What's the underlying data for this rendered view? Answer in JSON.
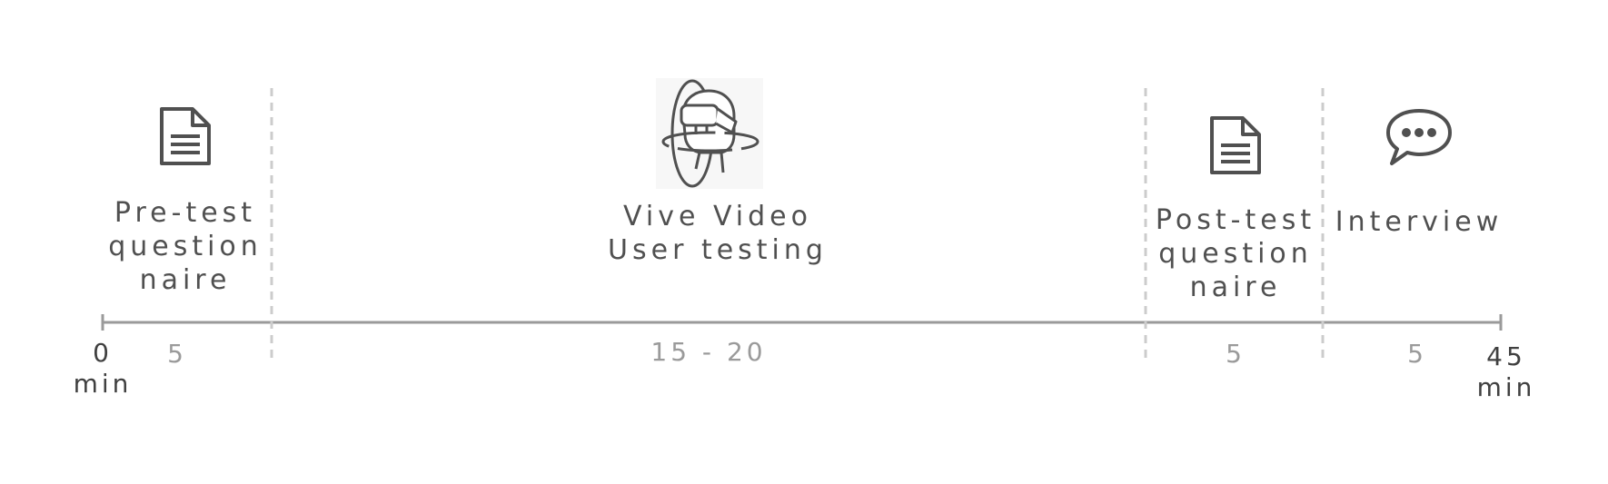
{
  "phases": [
    {
      "label": "Pre-test\nquestion\nnaire",
      "icon": "document-icon",
      "duration": "5"
    },
    {
      "label": "Vive Video\nUser testing",
      "icon": "vr-headset-user-icon",
      "duration": "15 - 20"
    },
    {
      "label": "Post-test\nquestion\nnaire",
      "icon": "document-icon",
      "duration": "5"
    },
    {
      "label": "Interview",
      "icon": "speech-bubble-icon",
      "duration": "5"
    }
  ],
  "timeline": {
    "start": "0\nmin",
    "end": "45\nmin"
  },
  "colors": {
    "line": "#9a9a9a",
    "divider": "#cccccc",
    "icon": "#505050",
    "text": "#505050",
    "duration": "#9a9a9a"
  }
}
